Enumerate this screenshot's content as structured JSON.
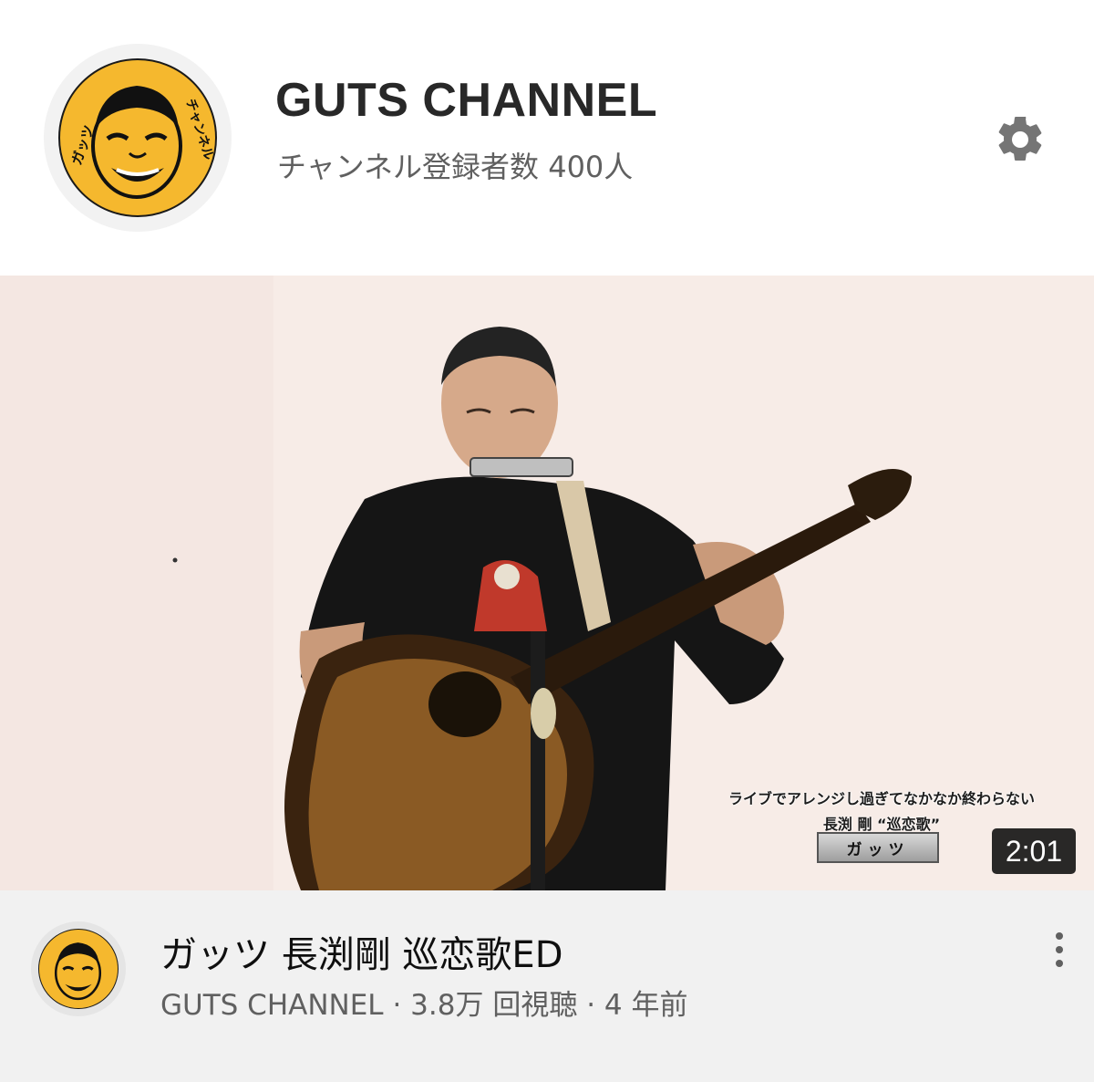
{
  "channel": {
    "name": "GUTS CHANNEL",
    "subscribers": "チャンネル登録者数 400人",
    "avatar_text_left": "ガッツ",
    "avatar_text_right": "チャンネル",
    "avatar_color": "#f5b82e"
  },
  "settings": {
    "icon": "gear-icon"
  },
  "video": {
    "duration": "2:01",
    "caption_line1": "ライブでアレンジし過ぎてなかなか終わらない",
    "caption_line2": "長渕 剛 “巡恋歌”",
    "caption_tag": "ガッツ",
    "title": "ガッツ 長渕剛 巡恋歌ED",
    "channel": "GUTS CHANNEL",
    "separator1": "·",
    "views": "3.8万 回視聴",
    "separator2": "·",
    "age": "4 年前"
  },
  "menu": {
    "icon": "more-vert-icon"
  }
}
